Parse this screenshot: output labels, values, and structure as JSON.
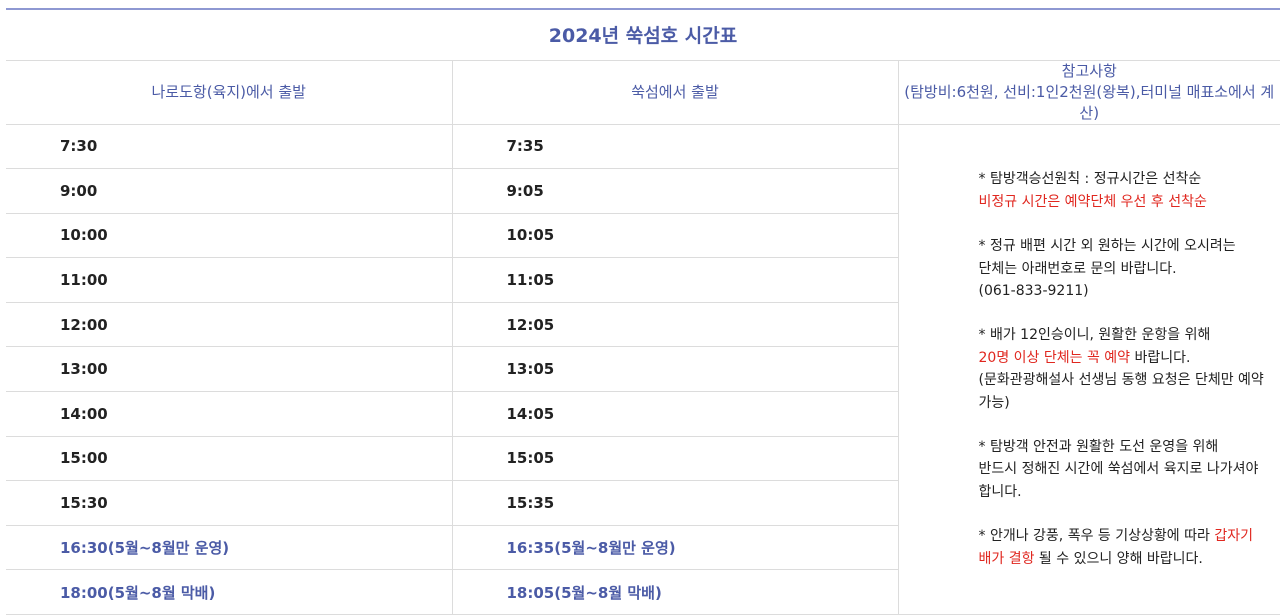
{
  "title": "2024년 쑥섬호 시간표",
  "headers": {
    "col1": "나로도항(육지)에서 출발",
    "col2": "쑥섬에서 출발",
    "col3_line1": "참고사항",
    "col3_line2": "(탐방비:6천원, 선비:1인2천원(왕복),터미널 매표소에서 계산)"
  },
  "rows": [
    {
      "from_mainland": "7:30",
      "from_island": "7:35",
      "special": false
    },
    {
      "from_mainland": "9:00",
      "from_island": "9:05",
      "special": false
    },
    {
      "from_mainland": "10:00",
      "from_island": "10:05",
      "special": false
    },
    {
      "from_mainland": "11:00",
      "from_island": "11:05",
      "special": false
    },
    {
      "from_mainland": "12:00",
      "from_island": "12:05",
      "special": false
    },
    {
      "from_mainland": "13:00",
      "from_island": "13:05",
      "special": false
    },
    {
      "from_mainland": "14:00",
      "from_island": "14:05",
      "special": false
    },
    {
      "from_mainland": "15:00",
      "from_island": "15:05",
      "special": false
    },
    {
      "from_mainland": "15:30",
      "from_island": "15:35",
      "special": false
    },
    {
      "from_mainland": "16:30(5월~8월만 운영)",
      "from_island": "16:35(5월~8월만 운영)",
      "special": true
    },
    {
      "from_mainland": "18:00(5월~8월 막배)",
      "from_island": "18:05(5월~8월 막배)",
      "special": true
    }
  ],
  "notes": {
    "n1_a": "* 탐방객승선원칙 : 정규시간은 선착순",
    "n1_b": "비정규 시간은 예약단체 우선 후 선착순",
    "n2_a": "* 정규 배편 시간 외 원하는 시간에 오시려는",
    "n2_b": "단체는 아래번호로 문의 바랍니다.",
    "n2_c": "(061-833-9211)",
    "n3_a": "* 배가 12인승이니, 원활한 운항을 위해",
    "n3_b_red": "20명 이상 단체는 꼭 예약",
    "n3_b_rest": " 바랍니다.",
    "n3_c": "(문화관광해설사 선생님 동행 요청은 단체만 예약",
    "n3_d": "가능)",
    "n4_a": "* 탐방객 안전과 원활한 도선 운영을 위해",
    "n4_b": "반드시 정해진 시간에 쑥섬에서 육지로 나가셔야",
    "n4_c": "합니다.",
    "n5_a": "* 안개나 강풍, 폭우 등 기상상황에 따라 ",
    "n5_a_red": "갑자기",
    "n5_b_red": "배가 결항",
    "n5_b_rest": " 될 수 있으니 양해 바랍니다."
  },
  "colors": {
    "accent": "#4b5ba6",
    "alert": "#e0271f",
    "border": "#dcdcdc"
  }
}
